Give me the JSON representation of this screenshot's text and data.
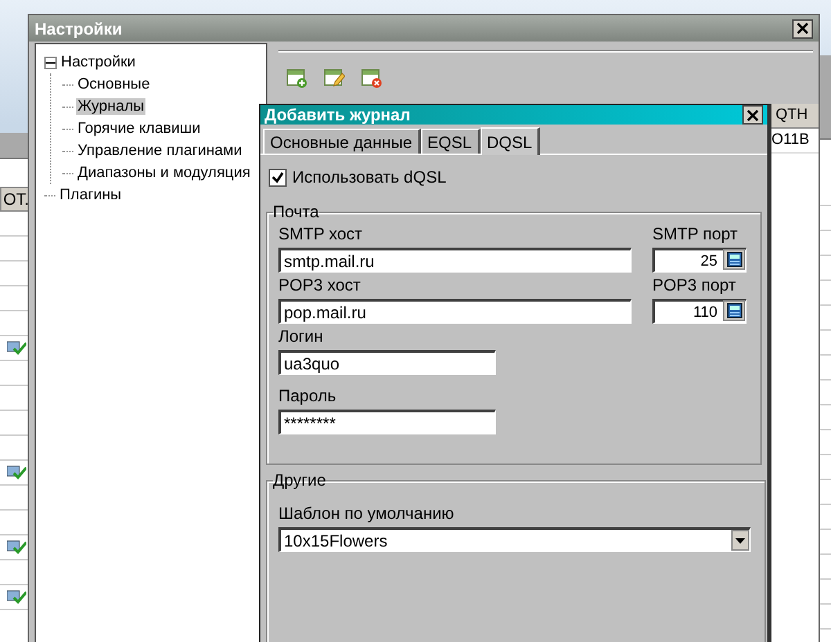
{
  "background_app": {
    "column_header": "ОТ.",
    "rows": [
      {
        "confirmed": false
      },
      {
        "confirmed": false
      },
      {
        "confirmed": false
      },
      {
        "confirmed": false
      },
      {
        "confirmed": false
      },
      {
        "confirmed": true
      },
      {
        "confirmed": false
      },
      {
        "confirmed": false
      },
      {
        "confirmed": false
      },
      {
        "confirmed": false
      },
      {
        "confirmed": true
      },
      {
        "confirmed": false
      },
      {
        "confirmed": false
      },
      {
        "confirmed": true
      },
      {
        "confirmed": false
      },
      {
        "confirmed": true
      }
    ]
  },
  "window": {
    "title": "Настройки"
  },
  "tree": [
    {
      "label": "Настройки",
      "expanded": true,
      "selected": false,
      "children": [
        {
          "label": "Основные",
          "selected": false
        },
        {
          "label": "Журналы",
          "selected": true
        },
        {
          "label": "Горячие клавиши",
          "selected": false
        },
        {
          "label": "Управление плагинами",
          "selected": false
        },
        {
          "label": "Диапазоны и модуляция",
          "selected": false
        }
      ]
    },
    {
      "label": "Плагины",
      "selected": false
    }
  ],
  "log_table": {
    "header": "QTH",
    "cell": "O11B"
  },
  "dialog": {
    "title": "Добавить журнал",
    "tabs": [
      {
        "label": "Основные данные",
        "selected": false
      },
      {
        "label": "EQSL",
        "selected": false
      },
      {
        "label": "DQSL",
        "selected": true
      }
    ],
    "use_dqsl": {
      "label": "Использовать dQSL",
      "checked": true
    },
    "mail": {
      "title": "Почта",
      "smtp_host": {
        "label": "SMTP хост",
        "value": "smtp.mail.ru"
      },
      "smtp_port": {
        "label": "SMTP порт",
        "value": "25"
      },
      "pop3_host": {
        "label": "POP3 хост",
        "value": "pop.mail.ru"
      },
      "pop3_port": {
        "label": "POP3 порт",
        "value": "110"
      },
      "login": {
        "label": "Логин",
        "value": "ua3quo"
      },
      "password": {
        "label": "Пароль",
        "value": "********"
      }
    },
    "other": {
      "title": "Другие",
      "template": {
        "label": "Шаблон по умолчанию",
        "value": "10x15Flowers"
      }
    }
  }
}
